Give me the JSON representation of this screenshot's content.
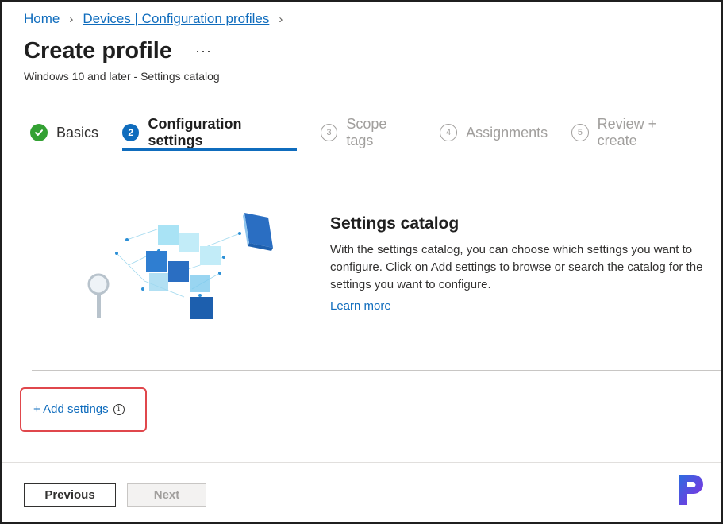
{
  "breadcrumb": {
    "home": "Home",
    "sep1": "›",
    "devices": "Devices | Configuration profiles",
    "sep2": "›"
  },
  "header": {
    "title": "Create profile",
    "more": "···",
    "subtitle": "Windows 10 and later - Settings catalog"
  },
  "steps": [
    {
      "num": "",
      "label": "Basics",
      "state": "done"
    },
    {
      "num": "2",
      "label": "Configuration settings",
      "state": "active"
    },
    {
      "num": "3",
      "label": "Scope tags",
      "state": "todo"
    },
    {
      "num": "4",
      "label": "Assignments",
      "state": "todo"
    },
    {
      "num": "5",
      "label": "Review + create",
      "state": "todo"
    }
  ],
  "catalog": {
    "title": "Settings catalog",
    "description": "With the settings catalog, you can choose which settings you want to configure. Click on Add settings to browse or search the catalog for the settings you want to configure.",
    "learn_more": "Learn more"
  },
  "add_settings": {
    "label": "+ Add settings",
    "info": "i"
  },
  "footer": {
    "previous": "Previous",
    "next": "Next"
  },
  "colors": {
    "accent": "#0f6cbd",
    "success": "#33a133",
    "highlight": "#e0474c",
    "disabled": "#a19f9d"
  },
  "icons": {
    "done": "checkmark-icon",
    "more": "ellipsis-icon",
    "info": "info-icon",
    "logo": "brand-logo-p"
  }
}
